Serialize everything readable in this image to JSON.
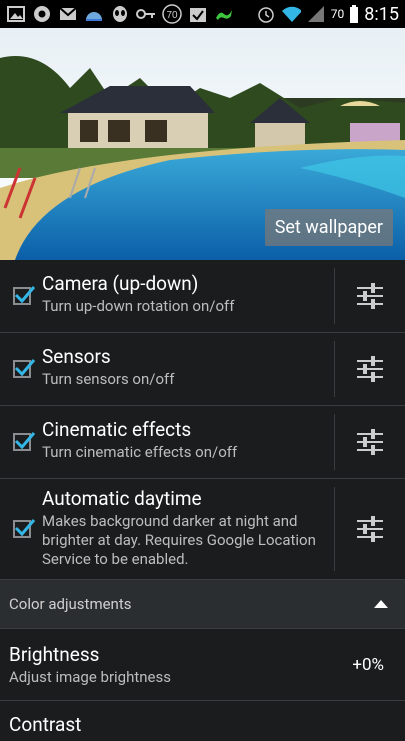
{
  "status_bar": {
    "left_icons": [
      "image-icon",
      "chrome-icon",
      "gmail-icon",
      "weather-icon",
      "alien-icon",
      "key-icon",
      "badge-70-icon",
      "check-task-icon",
      "lizard-icon"
    ],
    "badge_number": "70",
    "battery_percent": "70",
    "time": "8:15"
  },
  "preview": {
    "set_wallpaper_label": "Set wallpaper"
  },
  "settings": [
    {
      "title": "Camera (up-down)",
      "summary": "Turn up-down rotation on/off",
      "checked": true
    },
    {
      "title": "Sensors",
      "summary": "Turn sensors on/off",
      "checked": true
    },
    {
      "title": "Cinematic effects",
      "summary": "Turn cinematic effects on/off",
      "checked": true
    },
    {
      "title": "Automatic daytime",
      "summary": "Makes background darker at night and brighter at day. Requires Google Location Service to be enabled.",
      "checked": true
    }
  ],
  "category": {
    "label": "Color adjustments"
  },
  "brightness": {
    "title": "Brightness",
    "summary": "Adjust image brightness",
    "value": "+0%"
  },
  "next_item": {
    "title": "Contrast"
  },
  "colors": {
    "accent": "#33b5e5",
    "background": "#1a1c1e",
    "category_bg": "#2b2e31"
  }
}
